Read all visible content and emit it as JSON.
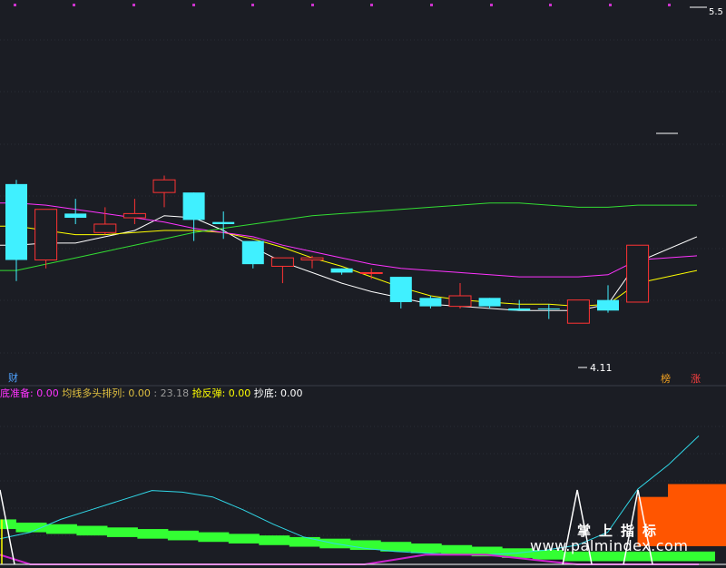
{
  "chart_data": [
    {
      "type": "candlestick",
      "title": "",
      "price_marks": {
        "high": "5.5",
        "low": "4.11"
      },
      "ylim": [
        3.95,
        5.65
      ],
      "candles": [
        {
          "o": 4.82,
          "h": 4.84,
          "l": 4.36,
          "c": 4.46,
          "up": false
        },
        {
          "o": 4.46,
          "h": 4.7,
          "l": 4.42,
          "c": 4.7,
          "up": true
        },
        {
          "o": 4.68,
          "h": 4.75,
          "l": 4.63,
          "c": 4.66,
          "up": false
        },
        {
          "o": 4.59,
          "h": 4.71,
          "l": 4.58,
          "c": 4.63,
          "up": true
        },
        {
          "o": 4.66,
          "h": 4.75,
          "l": 4.63,
          "c": 4.68,
          "up": true
        },
        {
          "o": 4.78,
          "h": 4.86,
          "l": 4.71,
          "c": 4.84,
          "up": true
        },
        {
          "o": 4.78,
          "h": 4.78,
          "l": 4.55,
          "c": 4.65,
          "up": false
        },
        {
          "o": 4.64,
          "h": 4.69,
          "l": 4.56,
          "c": 4.63,
          "up": false
        },
        {
          "o": 4.55,
          "h": 4.55,
          "l": 4.42,
          "c": 4.44,
          "up": false
        },
        {
          "o": 4.43,
          "h": 4.47,
          "l": 4.35,
          "c": 4.47,
          "up": true
        },
        {
          "o": 4.46,
          "h": 4.48,
          "l": 4.42,
          "c": 4.47,
          "up": true
        },
        {
          "o": 4.42,
          "h": 4.42,
          "l": 4.39,
          "c": 4.4,
          "up": false
        },
        {
          "o": 4.4,
          "h": 4.42,
          "l": 4.37,
          "c": 4.4,
          "up": true
        },
        {
          "o": 4.38,
          "h": 4.38,
          "l": 4.23,
          "c": 4.26,
          "up": false
        },
        {
          "o": 4.28,
          "h": 4.29,
          "l": 4.23,
          "c": 4.24,
          "up": false
        },
        {
          "o": 4.24,
          "h": 4.35,
          "l": 4.23,
          "c": 4.29,
          "up": true
        },
        {
          "o": 4.28,
          "h": 4.28,
          "l": 4.23,
          "c": 4.24,
          "up": false
        },
        {
          "o": 4.23,
          "h": 4.27,
          "l": 4.22,
          "c": 4.22,
          "up": false
        },
        {
          "o": 4.23,
          "h": 4.25,
          "l": 4.18,
          "c": 4.23,
          "up": false
        },
        {
          "o": 4.16,
          "h": 4.27,
          "l": 4.16,
          "c": 4.27,
          "up": true
        },
        {
          "o": 4.27,
          "h": 4.34,
          "l": 4.21,
          "c": 4.22,
          "up": false
        },
        {
          "o": 4.26,
          "h": 4.53,
          "l": 4.26,
          "c": 4.53,
          "up": true
        }
      ],
      "series": [
        {
          "color": "#ffffff",
          "values": [
            4.53,
            4.54,
            4.54,
            4.57,
            4.6,
            4.67,
            4.66,
            4.6,
            4.52,
            4.45,
            4.4,
            4.35,
            4.31,
            4.28,
            4.25,
            4.24,
            4.23,
            4.22,
            4.22,
            4.22,
            4.25,
            4.45
          ]
        },
        {
          "color": "#ffff00",
          "values": [
            4.62,
            4.6,
            4.58,
            4.58,
            4.59,
            4.6,
            4.6,
            4.59,
            4.56,
            4.52,
            4.47,
            4.43,
            4.38,
            4.33,
            4.29,
            4.27,
            4.26,
            4.25,
            4.25,
            4.24,
            4.25,
            4.35
          ]
        },
        {
          "color": "#ff33ff",
          "values": [
            4.73,
            4.72,
            4.7,
            4.68,
            4.66,
            4.64,
            4.61,
            4.59,
            4.57,
            4.53,
            4.5,
            4.47,
            4.44,
            4.42,
            4.41,
            4.4,
            4.39,
            4.38,
            4.38,
            4.38,
            4.39,
            4.46
          ]
        },
        {
          "color": "#33dd33",
          "values": [
            4.41,
            4.44,
            4.47,
            4.5,
            4.53,
            4.56,
            4.59,
            4.61,
            4.63,
            4.65,
            4.67,
            4.68,
            4.69,
            4.7,
            4.71,
            4.72,
            4.73,
            4.73,
            4.72,
            4.71,
            4.71,
            4.72
          ]
        }
      ],
      "ylabels": []
    },
    {
      "type": "indicator",
      "ylim": [
        0,
        100
      ],
      "line_cyan": [
        16,
        20,
        28,
        34,
        40,
        46,
        45,
        42,
        34,
        25,
        17,
        13,
        10,
        8,
        7,
        6,
        6,
        7,
        9,
        12,
        20,
        47,
        62,
        80
      ],
      "line_magenta": [
        6,
        0,
        0,
        0,
        0,
        0,
        0,
        0,
        0,
        0,
        0,
        0,
        0,
        3,
        6,
        6,
        6,
        4,
        2,
        0,
        0,
        0,
        0,
        0
      ],
      "green_bar": [
        22,
        20,
        19,
        18,
        17,
        16,
        15,
        14,
        13,
        12,
        11,
        10,
        9,
        8,
        7,
        6,
        5,
        4,
        3,
        2,
        2,
        2,
        2,
        2
      ],
      "orange_blocks": [
        0,
        0,
        0,
        0,
        0,
        0,
        0,
        0,
        0,
        0,
        0,
        0,
        0,
        0,
        0,
        0,
        0,
        0,
        0,
        0,
        0,
        0,
        22,
        30
      ],
      "spikes": [
        1,
        0,
        0,
        0,
        0,
        0,
        0,
        0,
        0,
        0,
        0,
        0,
        0,
        0,
        0,
        0,
        0,
        0,
        0,
        1,
        0,
        1,
        0,
        0
      ]
    }
  ],
  "labels": {
    "cai": "财",
    "bang": "榜",
    "zhang": "涨"
  },
  "indicators": [
    {
      "text": "底准备: 0.00",
      "color": "#ff33ff"
    },
    {
      "text": "  均线多头排列: 0.00",
      "color": "#e0c040"
    },
    {
      "text": "  : 23.18",
      "color": "#9a9a9a"
    },
    {
      "text": "  抢反弹: 0.00",
      "color": "#ffff00"
    },
    {
      "text": "  抄底: 0.00",
      "color": "#ffffff"
    }
  ],
  "watermark": {
    "cn": "掌上指标",
    "url": "www.palmindex.com"
  }
}
